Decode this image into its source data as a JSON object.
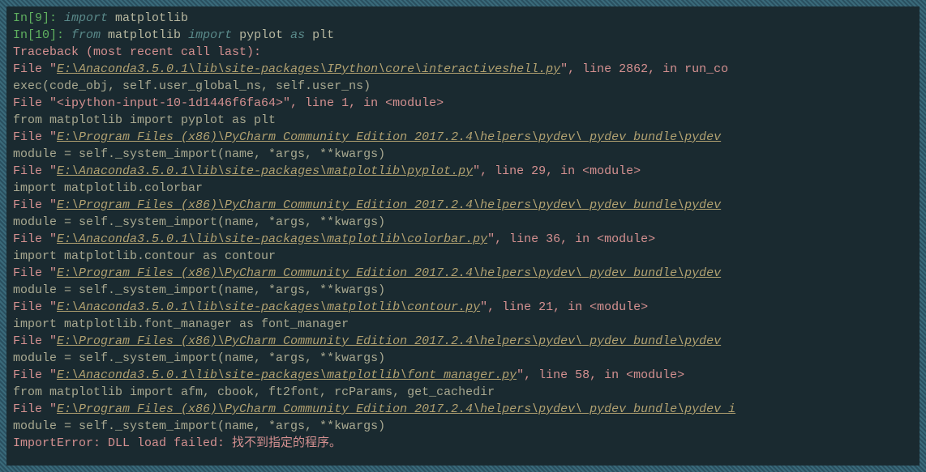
{
  "input9": {
    "prompt": "In[9]: ",
    "keyword1": "import",
    "module": " matplotlib"
  },
  "input10": {
    "prompt": "In[10]: ",
    "keyword1": "from",
    "module1": " matplotlib ",
    "keyword2": "import",
    "module2": " pyplot ",
    "keyword3": "as",
    "module3": " plt"
  },
  "traceback": {
    "header": "Traceback (most recent call last):",
    "frames": [
      {
        "file_prefix": "  File \"",
        "path": "E:\\Anaconda3.5.0.1\\lib\\site-packages\\IPython\\core\\interactiveshell.py",
        "suffix": "\", line 2862, in run_co",
        "code": "    exec(code_obj, self.user_global_ns, self.user_ns)"
      },
      {
        "file_prefix": "  File \"<ipython-input-10-1d1446f6fa64>\", line 1, in <module>",
        "path": "",
        "suffix": "",
        "code": "    from matplotlib import pyplot as plt"
      },
      {
        "file_prefix": "  File \"",
        "path": "E:\\Program Files (x86)\\PyCharm Community Edition 2017.2.4\\helpers\\pydev\\_pydev_bundle\\pydev",
        "suffix": "",
        "code": "    module = self._system_import(name, *args, **kwargs)"
      },
      {
        "file_prefix": "  File \"",
        "path": "E:\\Anaconda3.5.0.1\\lib\\site-packages\\matplotlib\\pyplot.py",
        "suffix": "\", line 29, in <module>",
        "code": "    import matplotlib.colorbar"
      },
      {
        "file_prefix": "  File \"",
        "path": "E:\\Program Files (x86)\\PyCharm Community Edition 2017.2.4\\helpers\\pydev\\_pydev_bundle\\pydev",
        "suffix": "",
        "code": "    module = self._system_import(name, *args, **kwargs)"
      },
      {
        "file_prefix": "  File \"",
        "path": "E:\\Anaconda3.5.0.1\\lib\\site-packages\\matplotlib\\colorbar.py",
        "suffix": "\", line 36, in <module>",
        "code": "    import matplotlib.contour as contour"
      },
      {
        "file_prefix": "  File \"",
        "path": "E:\\Program Files (x86)\\PyCharm Community Edition 2017.2.4\\helpers\\pydev\\_pydev_bundle\\pydev",
        "suffix": "",
        "code": "    module = self._system_import(name, *args, **kwargs)"
      },
      {
        "file_prefix": "  File \"",
        "path": "E:\\Anaconda3.5.0.1\\lib\\site-packages\\matplotlib\\contour.py",
        "suffix": "\", line 21, in <module>",
        "code": "    import matplotlib.font_manager as font_manager"
      },
      {
        "file_prefix": "  File \"",
        "path": "E:\\Program Files (x86)\\PyCharm Community Edition 2017.2.4\\helpers\\pydev\\_pydev_bundle\\pydev",
        "suffix": "",
        "code": "    module = self._system_import(name, *args, **kwargs)"
      },
      {
        "file_prefix": "  File \"",
        "path": "E:\\Anaconda3.5.0.1\\lib\\site-packages\\matplotlib\\font_manager.py",
        "suffix": "\", line 58, in <module>",
        "code": "    from matplotlib import afm, cbook, ft2font, rcParams, get_cachedir"
      },
      {
        "file_prefix": "  File \"",
        "path": "E:\\Program Files (x86)\\PyCharm Community Edition 2017.2.4\\helpers\\pydev\\_pydev_bundle\\pydev_i",
        "suffix": "",
        "code": "    module = self._system_import(name, *args, **kwargs)"
      }
    ],
    "error": "ImportError: DLL load failed: 找不到指定的程序。"
  }
}
